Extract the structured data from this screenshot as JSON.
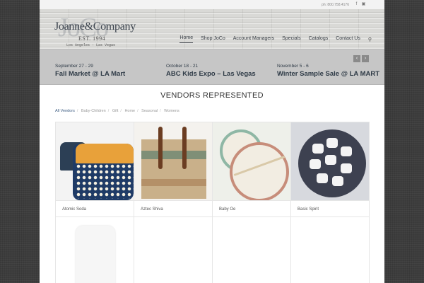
{
  "topbar": {
    "phone": "ph: 800.758.4176",
    "social": [
      "facebook-icon",
      "instagram-icon"
    ]
  },
  "logo": {
    "bg_text": "JoCo",
    "name": "Joanne&Company",
    "est": "EST. 1994",
    "locations": "Los Angeles - Las Vegas"
  },
  "nav": {
    "items": [
      "Home",
      "Shop JoCo",
      "Account Managers",
      "Specials",
      "Catalogs",
      "Contact Us"
    ],
    "active": "Home"
  },
  "events": [
    {
      "date": "September 27 - 29",
      "title": "Fall Market @ LA Mart"
    },
    {
      "date": "October 18 - 21",
      "title": "ABC Kids Expo – Las Vegas"
    },
    {
      "date": "November 5 - 6",
      "title": "Winter Sample Sale @ LA MART"
    }
  ],
  "section_title": "VENDORS REPRESENTED",
  "filters": [
    "All Vendors",
    "Baby-Children",
    "Gift",
    "Home",
    "Seasonal",
    "Womens"
  ],
  "vendors": [
    "Atomic Soda",
    "Aztec Shiva",
    "Baby Oe",
    "Basic Spirit"
  ],
  "colors": {
    "accent": "#3a5a80",
    "text_dark": "#2e3a46",
    "events_bg": "#c6c6c6"
  }
}
